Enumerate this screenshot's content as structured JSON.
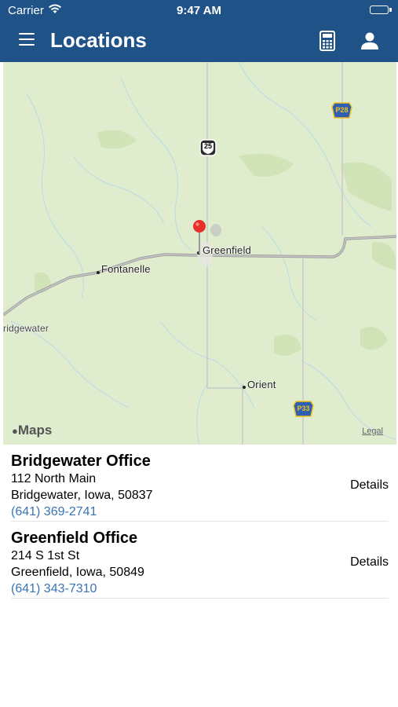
{
  "status_bar": {
    "carrier": "Carrier",
    "time": "9:47 AM"
  },
  "nav": {
    "title": "Locations"
  },
  "map": {
    "places": [
      "Greenfield",
      "Fontanelle",
      "ridgewater",
      "Orient"
    ],
    "road_shields": [
      "25",
      "P28",
      "P33"
    ],
    "attribution": "Maps",
    "legal": "Legal"
  },
  "locations": [
    {
      "name": "Bridgewater Office",
      "address_line1": "112 North Main",
      "address_line2": "Bridgewater, Iowa, 50837",
      "phone": "(641) 369-2741",
      "details_label": "Details"
    },
    {
      "name": "Greenfield Office",
      "address_line1": "214 S 1st St",
      "address_line2": "Greenfield, Iowa, 50849",
      "phone": "(641) 343-7310",
      "details_label": "Details"
    }
  ],
  "colors": {
    "nav_bar": "#1f5387",
    "link": "#3a74b4",
    "map_land": "#dfeccd",
    "pin": "#e8302a"
  }
}
